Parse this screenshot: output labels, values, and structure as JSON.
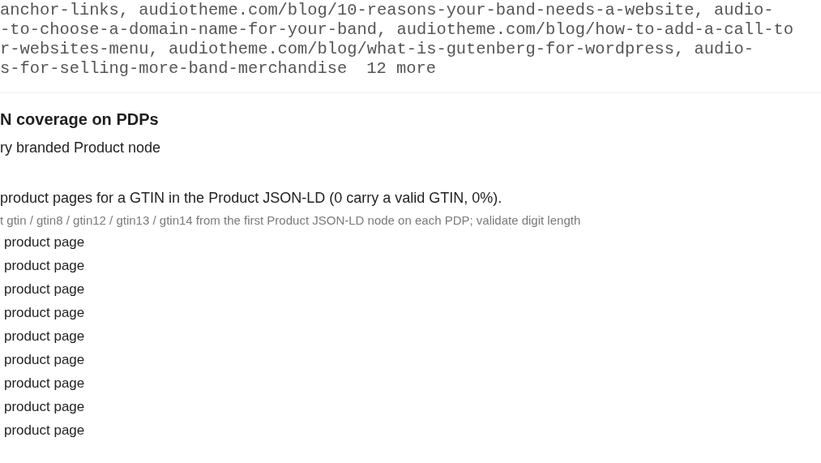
{
  "url_list": {
    "lines": [
      "anchor-links, audiotheme.com/blog/10-reasons-your-band-needs-a-website, audio-",
      "-to-choose-a-domain-name-for-your-band, audiotheme.com/blog/how-to-add-a-call-to",
      "r-websites-menu, audiotheme.com/blog/what-is-gutenberg-for-wordpress, audio-",
      "s-for-selling-more-band-merchandise"
    ],
    "more": "12 more"
  },
  "check": {
    "title": "N coverage on PDPs",
    "subtitle": "ry branded Product node",
    "summary": "product pages for a GTIN in the Product JSON-LD (0 carry a valid GTIN, 0%).",
    "method": "t gtin / gtin8 / gtin12 / gtin13 / gtin14 from the first Product JSON-LD node on each PDP; validate digit length",
    "items": [
      "product page",
      "product page",
      "product page",
      "product page",
      "product page",
      "product page",
      "product page",
      "product page",
      "product page"
    ]
  }
}
